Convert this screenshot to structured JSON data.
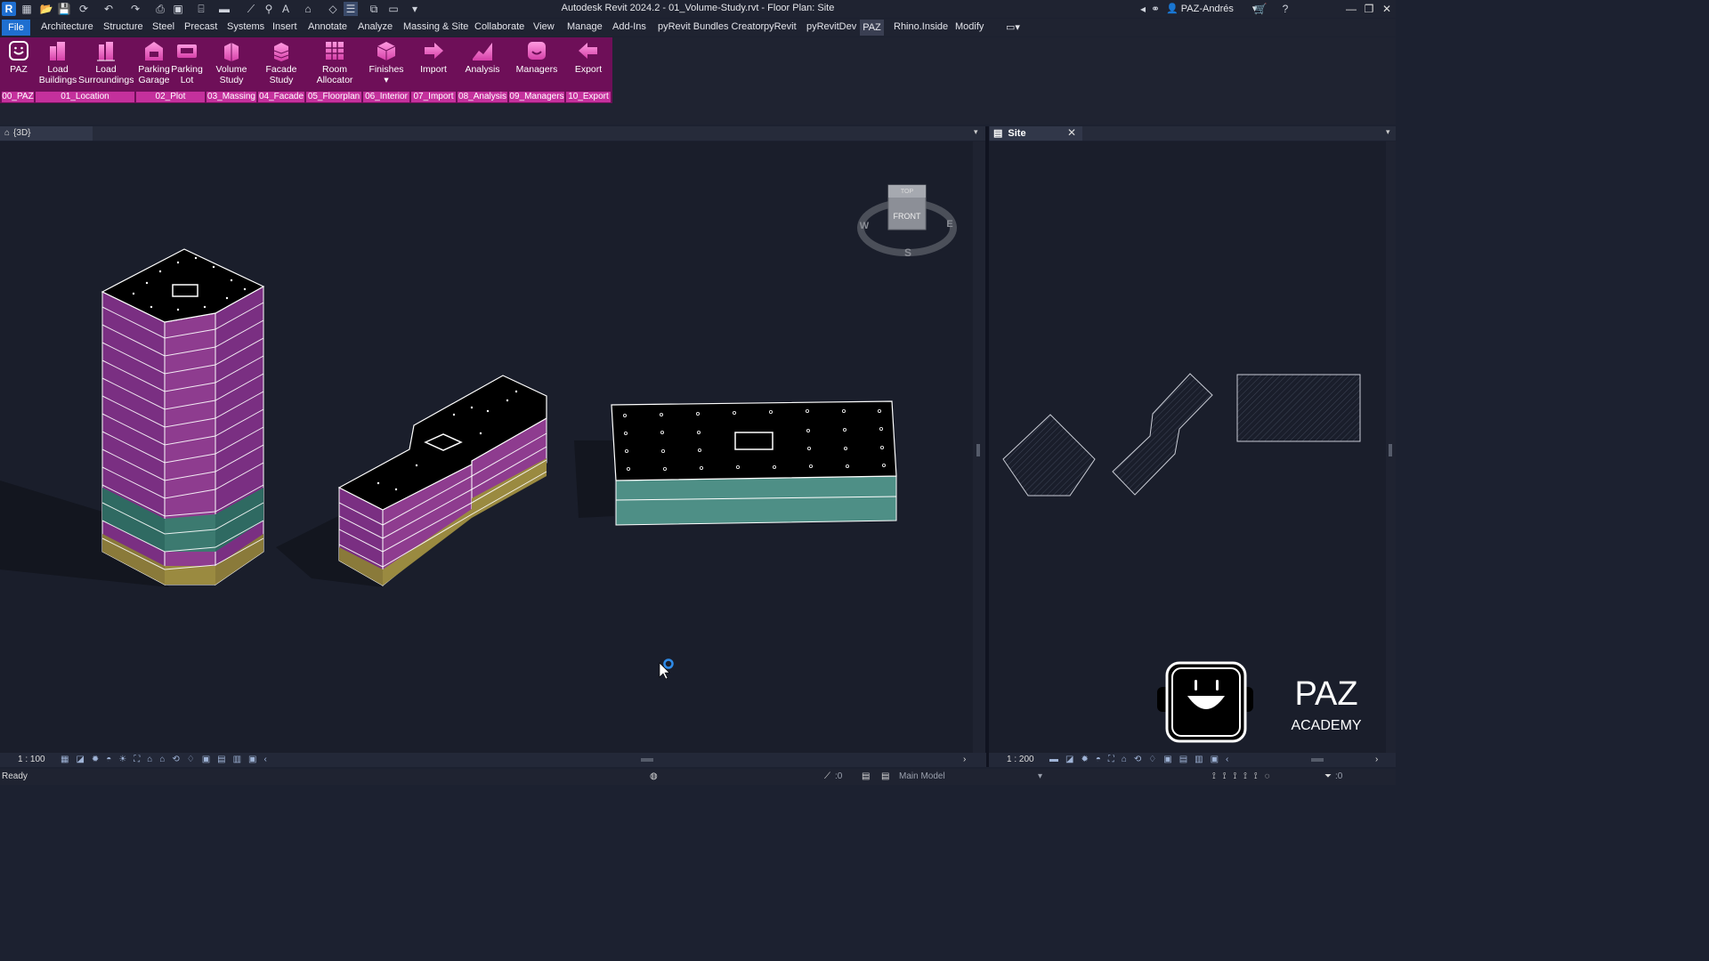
{
  "app": {
    "icon_letter": "R",
    "title": "Autodesk Revit 2024.2 - 01_Volume-Study.rvt - Floor Plan: Site",
    "user": "PAZ-Andrés"
  },
  "menu_tabs": [
    {
      "label": "File"
    },
    {
      "label": "Architecture"
    },
    {
      "label": "Structure"
    },
    {
      "label": "Steel"
    },
    {
      "label": "Precast"
    },
    {
      "label": "Systems"
    },
    {
      "label": "Insert"
    },
    {
      "label": "Annotate"
    },
    {
      "label": "Analyze"
    },
    {
      "label": "Massing & Site"
    },
    {
      "label": "Collaborate"
    },
    {
      "label": "View"
    },
    {
      "label": "Manage"
    },
    {
      "label": "Add-Ins"
    },
    {
      "label": "pyRevit Bundles Creator"
    },
    {
      "label": "pyRevit"
    },
    {
      "label": "pyRevitDev"
    },
    {
      "label": "PAZ"
    },
    {
      "label": "Rhino.Inside"
    },
    {
      "label": "Modify"
    }
  ],
  "ribbon": {
    "buttons": [
      {
        "line1": "PAZ",
        "line2": ""
      },
      {
        "line1": "Load",
        "line2": "Buildings"
      },
      {
        "line1": "Load",
        "line2": "Surroundings"
      },
      {
        "line1": "Parking",
        "line2": "Garage"
      },
      {
        "line1": "Parking",
        "line2": "Lot"
      },
      {
        "line1": "Volume",
        "line2": "Study"
      },
      {
        "line1": "Facade",
        "line2": "Study"
      },
      {
        "line1": "Room",
        "line2": "Allocator"
      },
      {
        "line1": "Finishes",
        "line2": "▾"
      },
      {
        "line1": "Import",
        "line2": ""
      },
      {
        "line1": "Analysis",
        "line2": ""
      },
      {
        "line1": "Managers",
        "line2": ""
      },
      {
        "line1": "Export",
        "line2": ""
      }
    ],
    "panels": [
      "00_PAZ",
      "01_Location",
      "02_Plot",
      "03_Massing",
      "04_Facade",
      "05_Floorplan",
      "06_Interior",
      "07_Import",
      "08_Analysis",
      "09_Managers",
      "10_Export"
    ],
    "accent": "#6e0f58",
    "panel_color": "#c4309c"
  },
  "views": {
    "left_tab": "{3D}",
    "right_tab": "Site",
    "viewcube_face": "FRONT",
    "viewcube_top": "TOP",
    "compass": {
      "w": "W",
      "e": "E",
      "s": "S"
    },
    "left_scale": "1 : 100",
    "right_scale": "1 : 200"
  },
  "watermark": {
    "line1": "PAZ",
    "line2": "ACADEMY"
  },
  "status": {
    "text": "Ready",
    "count": ":0",
    "model": "Main Model",
    "filter_count": ":0"
  }
}
